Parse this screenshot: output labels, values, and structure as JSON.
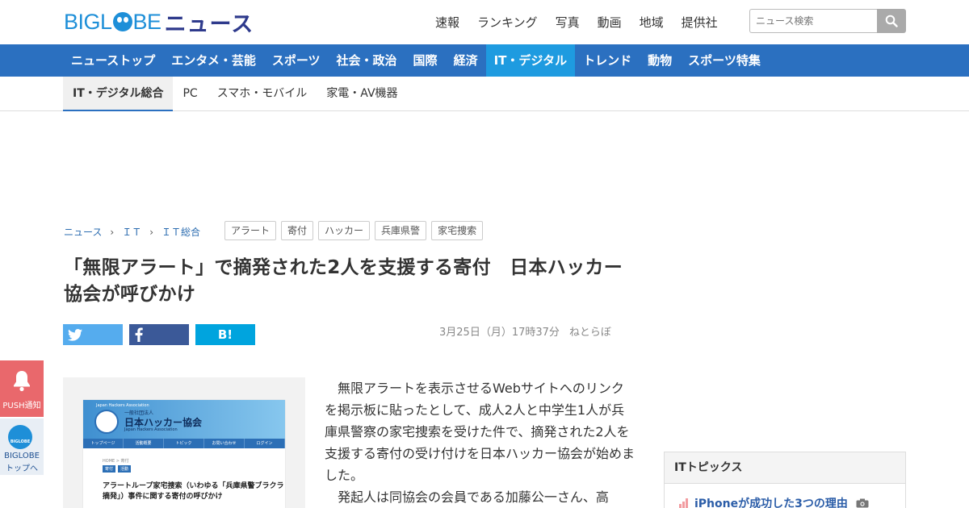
{
  "header": {
    "logo_text": "BIGL",
    "logo_text2": "BE",
    "logo_news": "ニュース",
    "top_links": [
      "速報",
      "ランキング",
      "写真",
      "動画",
      "地域",
      "提供社"
    ],
    "search_placeholder": "ニュース検索"
  },
  "main_nav": {
    "items": [
      "ニューストップ",
      "エンタメ・芸能",
      "スポーツ",
      "社会・政治",
      "国際",
      "経済",
      "IT・デジタル",
      "トレンド",
      "動物",
      "スポーツ特集"
    ],
    "active_index": 6
  },
  "sub_nav": {
    "items": [
      "IT・デジタル総合",
      "PC",
      "スマホ・モバイル",
      "家電・AV機器"
    ],
    "active_index": 0
  },
  "breadcrumb": [
    "ニュース",
    "ＩＴ",
    "ＩＴ総合"
  ],
  "tags": [
    "アラート",
    "寄付",
    "ハッカー",
    "兵庫県警",
    "家宅捜索"
  ],
  "article": {
    "title": "「無限アラート」で摘発された2人を支援する寄付　日本ハッカー協会が呼びかけ",
    "date": "3月25日（月）17時37分",
    "source": "ねとらぼ",
    "paragraphs": [
      "無限アラートを表示させるWebサイトへのリンクを掲示板に貼ったとして、成人2人と中学生1人が兵庫県警察の家宅捜索を受けた件で、摘発された2人を支援する寄付の受け付けを日本ハッカー協会が始めました。",
      "発起人は同協会の会員である加藤公一さん、高"
    ],
    "image": {
      "small": "Japan Hackers Association",
      "t1": "一般社団法人",
      "t2": "日本ハッカー協会",
      "t3": "Japan Hackers Association",
      "menu": [
        "トップページ",
        "活動概要",
        "トピック",
        "お問い合わせ",
        "ログイン"
      ],
      "crumb": "HOME > 寄付",
      "badges": [
        "寄付",
        "活動"
      ],
      "heading": "アラートループ家宅捜索（いわゆる「兵庫県警ブラクラ摘発」）事件に関する寄付の呼びかけ"
    }
  },
  "share": {
    "hatena": "B!"
  },
  "topics": {
    "heading": "ITトピックス",
    "first_item": "iPhoneが成功した3つの理由"
  },
  "floating": {
    "push": "PUSH通知",
    "big_logo": "BIGLOBE",
    "big_top_1": "BIGLOBE",
    "big_top_2": "トップへ"
  },
  "colors": {
    "brand_blue": "#1e8fd8",
    "nav_blue": "#2b70c0",
    "nav_active": "#1e9be0",
    "push_red": "#e9686c"
  }
}
